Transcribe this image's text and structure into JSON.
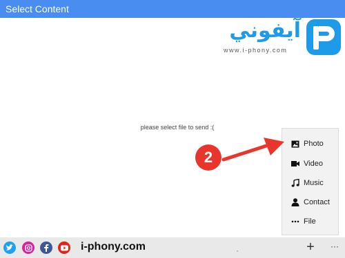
{
  "window": {
    "title": "Select Content"
  },
  "logo": {
    "arabic_text": "آيفوني",
    "url_text": "www.i-phony.com"
  },
  "main": {
    "empty_message": "please select file to send :("
  },
  "popup_menu": {
    "items": [
      {
        "label": "Photo",
        "icon": "photo-icon"
      },
      {
        "label": "Video",
        "icon": "video-icon"
      },
      {
        "label": "Music",
        "icon": "music-icon"
      },
      {
        "label": "Contact",
        "icon": "contact-icon"
      },
      {
        "label": "File",
        "icon": "file-icon"
      }
    ]
  },
  "annotation": {
    "step_number": "2",
    "color": "#e8362c"
  },
  "bottom_bar": {
    "social_icons": [
      "twitter-icon",
      "instagram-icon",
      "facebook-icon",
      "youtube-icon"
    ],
    "site_name": "i-phony.com",
    "add_label": "+",
    "more_label": "···"
  },
  "colors": {
    "titlebar": "#4a8df0",
    "brand": "#1d9be8",
    "bottom_bar": "#e9e9e9"
  }
}
